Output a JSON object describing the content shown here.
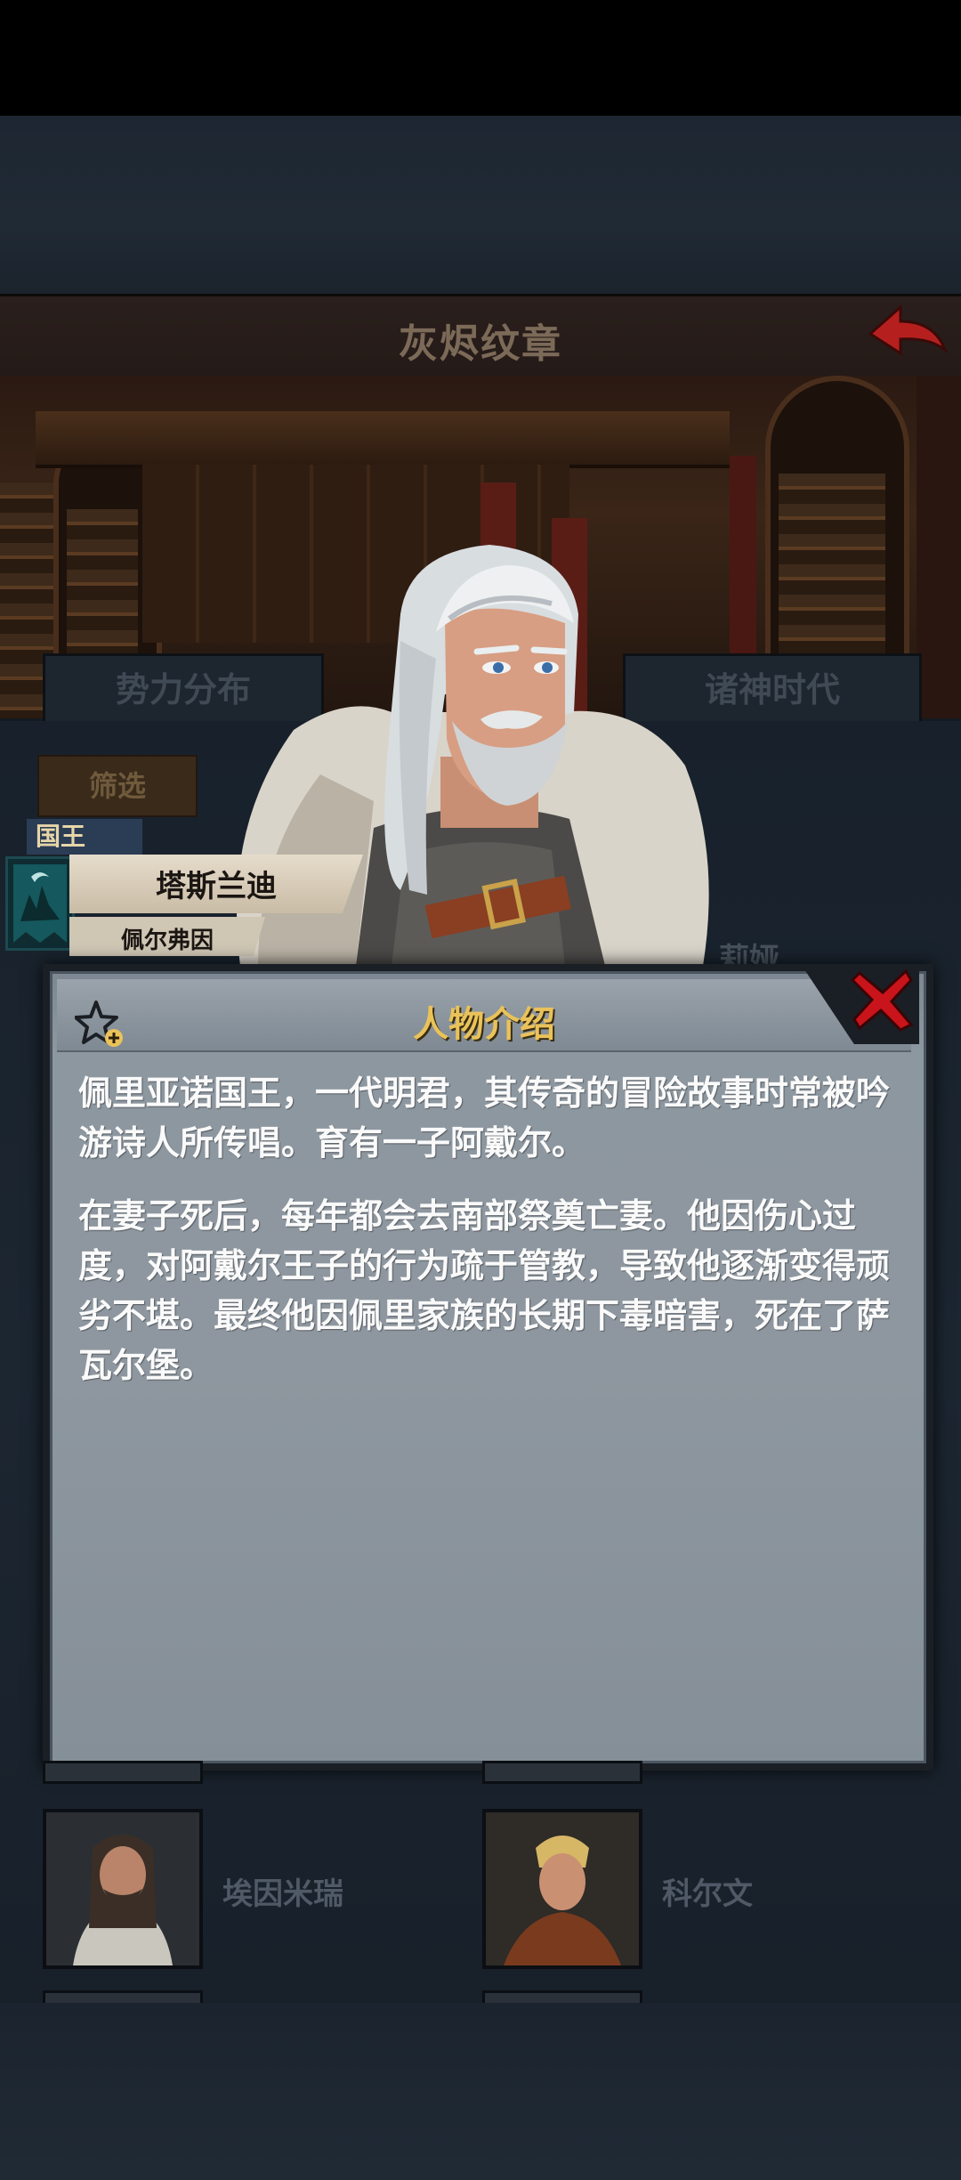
{
  "header": {
    "title": "灰烬纹章"
  },
  "tabs": [
    "势力分布",
    "诸神时代"
  ],
  "filter": {
    "label": "筛选"
  },
  "character": {
    "rank": "国王",
    "name": "塔斯兰迪",
    "house": "佩尔弗因",
    "partial_neighbor_name": "莉娅"
  },
  "panel": {
    "title": "人物介绍",
    "paragraphs": [
      "佩里亚诺国王，一代明君，其传奇的冒险故事时常被吟游诗人所传唱。育有一子阿戴尔。",
      "在妻子死后，每年都会去南部祭奠亡妻。他因伤心过度，对阿戴尔王子的行为疏于管教，导致他逐渐变得顽劣不堪。最终他因佩里家族的长期下毒暗害，死在了萨瓦尔堡。"
    ]
  },
  "list": [
    {
      "name": "埃因米瑞"
    },
    {
      "name": "科尔文"
    }
  ],
  "colors": {
    "accent_gold": "#e9c25a",
    "close_red": "#c8141a",
    "back_red": "#b5201e"
  },
  "icons": {
    "back": "back-arrow-icon",
    "close": "close-x-icon",
    "favorite": "star-plus-icon",
    "emblem": "house-banner-icon"
  }
}
